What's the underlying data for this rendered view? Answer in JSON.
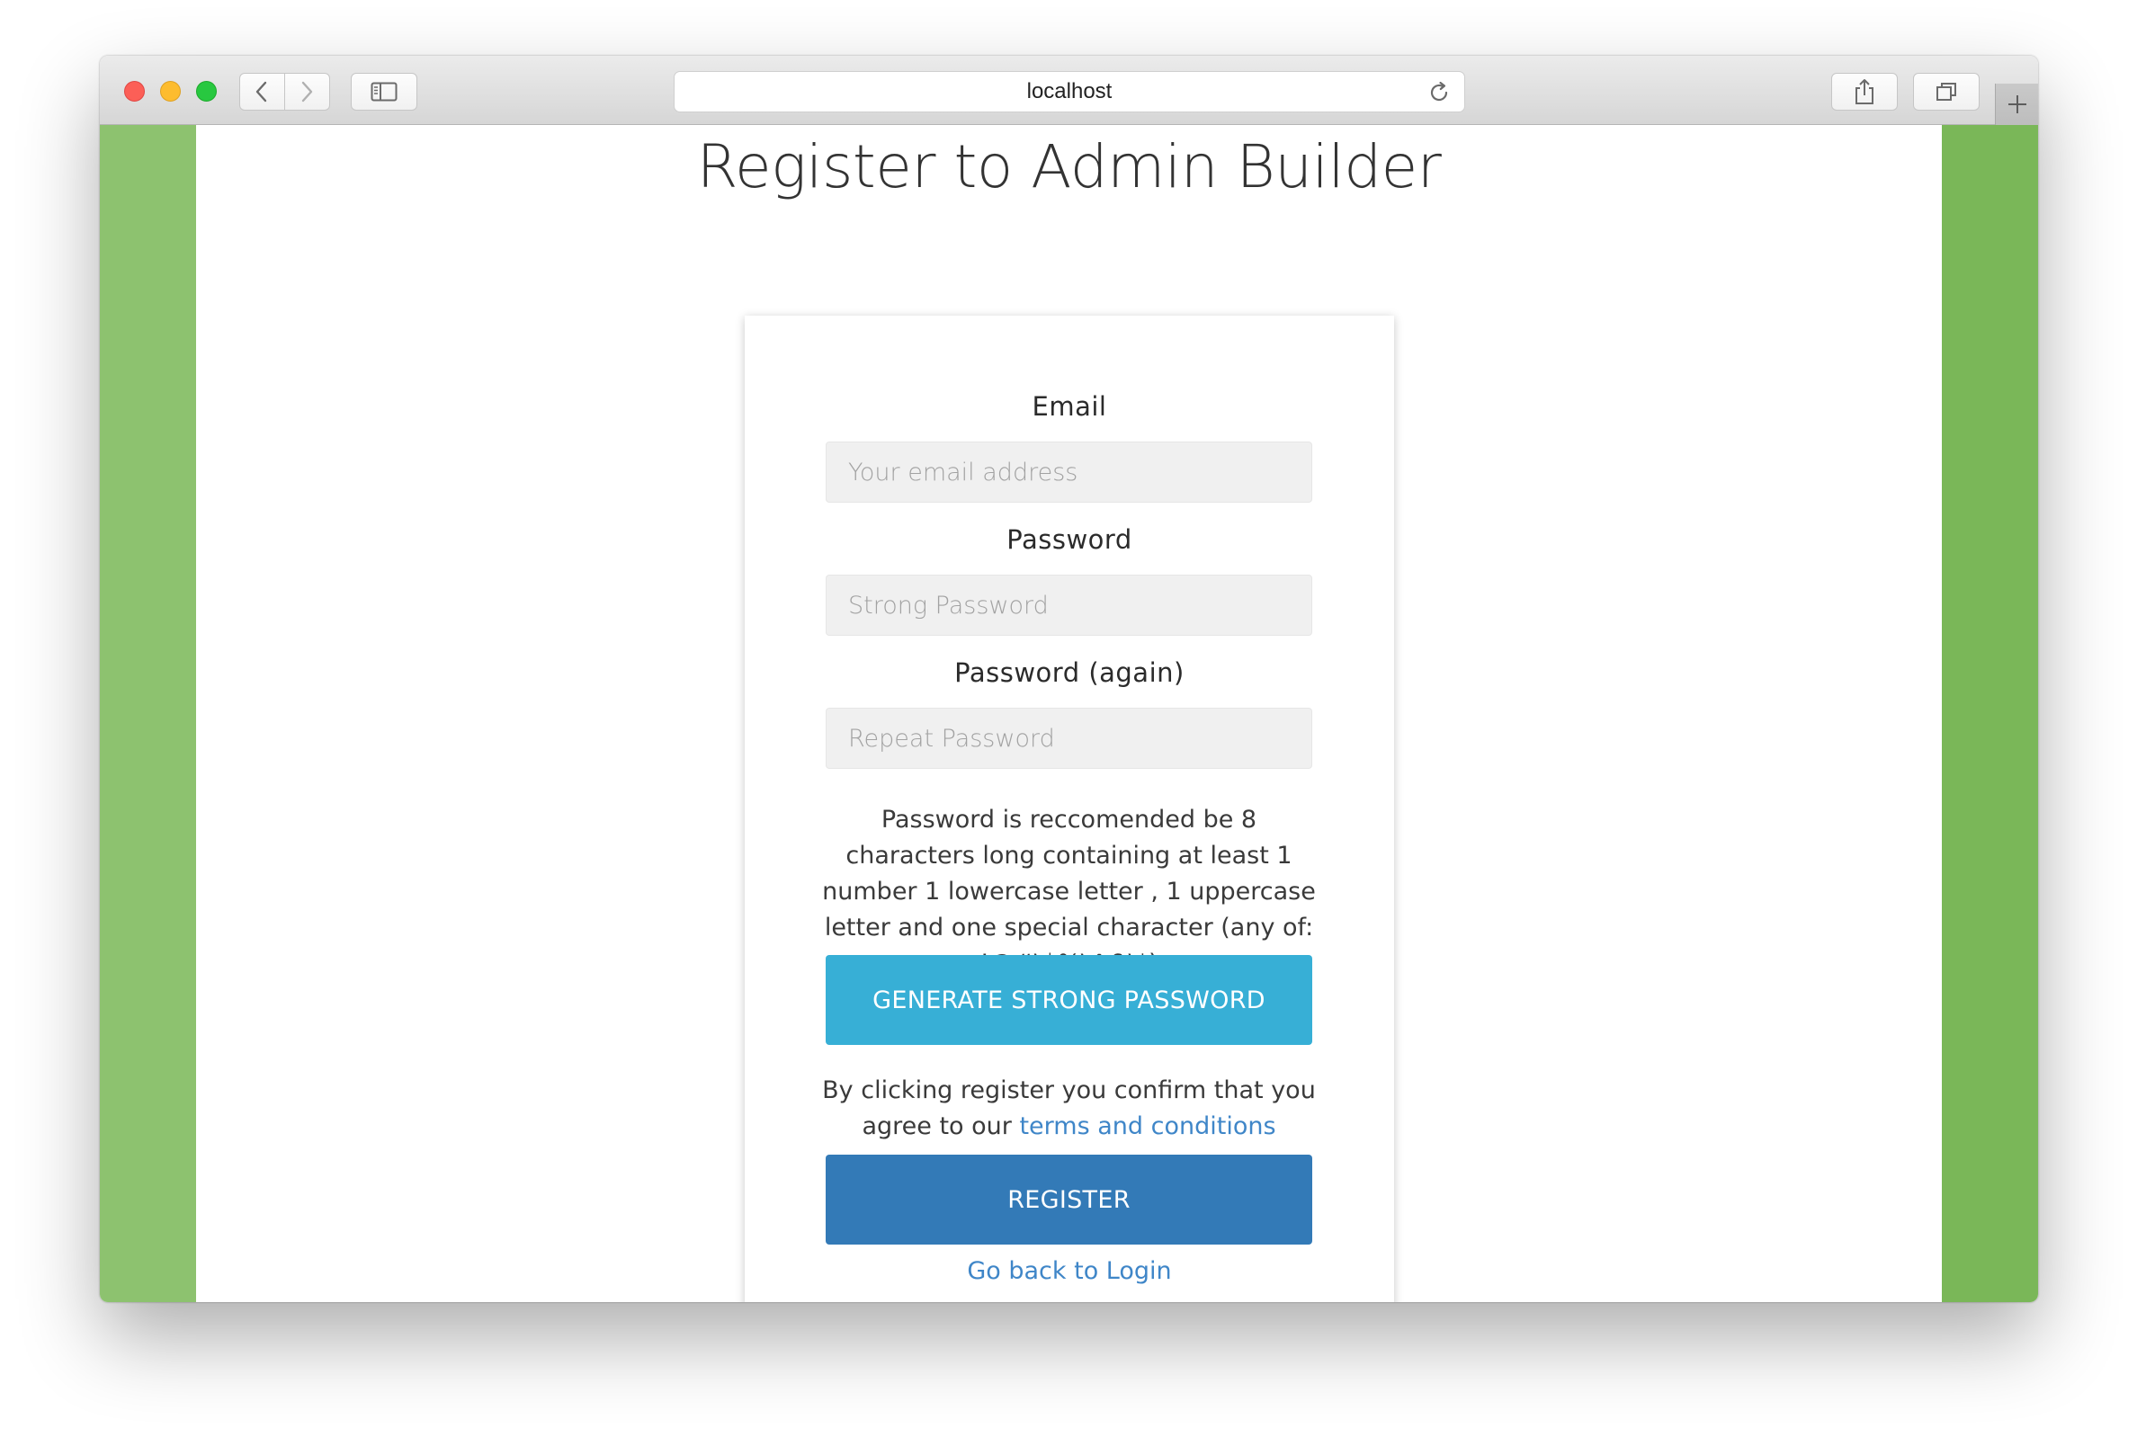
{
  "browser": {
    "address": "localhost",
    "tab_plus": "+"
  },
  "page": {
    "title": "Register to Admin Builder"
  },
  "form": {
    "email_label": "Email",
    "email_placeholder": "Your email address",
    "password_label": "Password",
    "password_placeholder": "Strong Password",
    "password_again_label": "Password (again)",
    "password_again_placeholder": "Repeat Password",
    "password_hint": "Password is reccomended be 8 characters long containing at least 1 number 1 lowercase letter , 1 uppercase letter and one special character (any of: !@#\\$%\\^&\\*)",
    "generate_button": "GENERATE STRONG PASSWORD",
    "confirm_text": "By clicking register you confirm that you agree to our",
    "terms_link": "terms and conditions",
    "register_button": "REGISTER",
    "back_link": "Go back to Login"
  },
  "colors": {
    "side_left": "#8dc26f",
    "side_right": "#7ab758",
    "generate_button": "#37afd6",
    "register_button": "#337ab7",
    "link": "#3f86c8"
  },
  "icons": [
    "back-arrow-icon",
    "forward-arrow-icon",
    "sidebar-icon",
    "reload-icon",
    "share-icon",
    "tabs-icon",
    "plus-icon"
  ]
}
